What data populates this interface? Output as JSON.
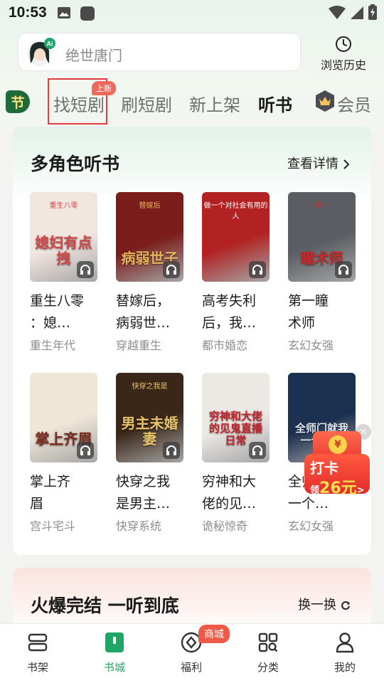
{
  "status_bar": {
    "time": "10:53"
  },
  "search": {
    "query": "绝世唐门",
    "avatar_badge": "Ai"
  },
  "header": {
    "history_label": "浏览历史"
  },
  "tabs": {
    "festival_badge": "节",
    "items": [
      {
        "label": "找短剧",
        "active": false
      },
      {
        "label": "刷短剧",
        "active": false
      },
      {
        "label": "新上架",
        "active": false
      },
      {
        "label": "听书",
        "active": true
      },
      {
        "label": "会员",
        "active": false
      }
    ],
    "new_badge": "上新"
  },
  "section1": {
    "title": "多角色听书",
    "more_label": "查看详情",
    "books": [
      {
        "title": "重生八零：媳…",
        "tag": "重生年代",
        "cover_text": "媳妇有点拽",
        "cover_small": "重生八零",
        "cover_color": "#f2e6e1",
        "accent": "#d14848"
      },
      {
        "title": "替嫁后，病弱世…",
        "tag": "穿越重生",
        "cover_text": "病弱世子",
        "cover_small": "替嫁后",
        "cover_color": "#7a1d1b",
        "accent": "#e3b35a"
      },
      {
        "title": "高考失利后，我…",
        "tag": "都市婚恋",
        "cover_text": "",
        "cover_small": "做一个对社会有用的人",
        "cover_color": "#b22222",
        "accent": "#ffffff"
      },
      {
        "title": "第一瞳术师",
        "tag": "玄幻女强",
        "cover_text": "瞳术师",
        "cover_small": "第一",
        "cover_color": "#5a5e63",
        "accent": "#c92a2a"
      },
      {
        "title": "掌上齐眉",
        "tag": "宫斗宅斗",
        "cover_text": "掌上齐眉",
        "cover_small": "",
        "cover_color": "#efe6d8",
        "accent": "#7a2b1e"
      },
      {
        "title": "快穿之我是男主…",
        "tag": "快穿系统",
        "cover_text": "男主未婚妻",
        "cover_small": "快穿之我是",
        "cover_color": "#3a2718",
        "accent": "#e8c36a"
      },
      {
        "title": "穷神和大佬的见…",
        "tag": "诡秘惊奇",
        "cover_text": "穷神和大佬的见鬼直播日常",
        "cover_small": "",
        "cover_color": "#ece8e4",
        "accent": "#c3232a"
      },
      {
        "title": "全师门我一个…",
        "tag": "玄幻女强",
        "cover_text": "全师门就我一个废柴",
        "cover_small": "",
        "cover_color": "#1c3050",
        "accent": "#e1e6f0"
      }
    ]
  },
  "float_checkin": {
    "title": "打卡",
    "prefix": "领",
    "amount": "26元",
    "suffix": ">",
    "coin": "¥",
    "close": "×"
  },
  "section2": {
    "title": "火爆完结 一听到底",
    "more_label": "换一换"
  },
  "bottom_nav": {
    "items": [
      {
        "label": "书架",
        "active": false
      },
      {
        "label": "书城",
        "active": true
      },
      {
        "label": "福利",
        "active": false
      },
      {
        "label": "分类",
        "active": false
      },
      {
        "label": "我的",
        "active": false
      }
    ],
    "welfare_badge": "商城"
  },
  "colors": {
    "accent_green": "#20a568",
    "badge_red": "#ee5a49"
  }
}
